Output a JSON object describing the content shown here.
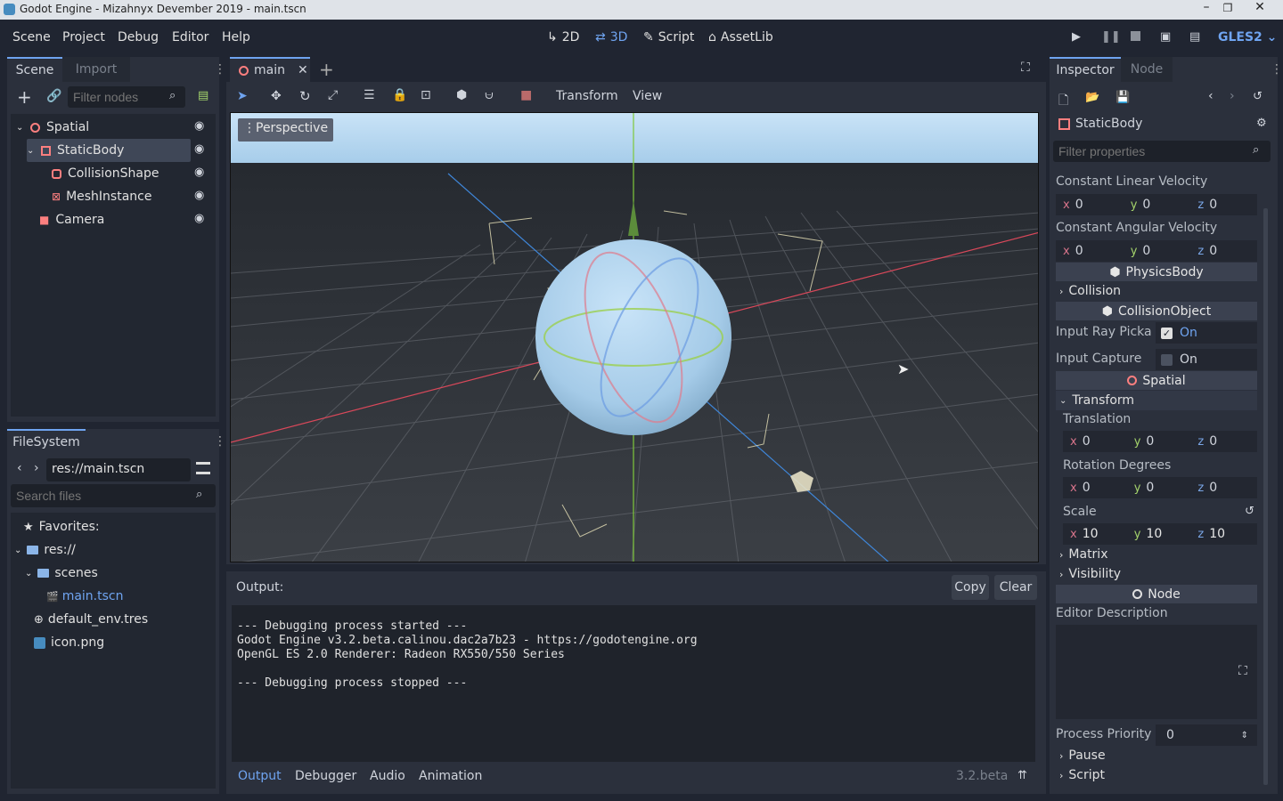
{
  "window": {
    "title": "Godot Engine - Mizahnyx Devember 2019 - main.tscn"
  },
  "menu": [
    "Scene",
    "Project",
    "Debug",
    "Editor",
    "Help"
  ],
  "modes": {
    "m2d": "2D",
    "m3d": "3D",
    "script": "Script",
    "assetlib": "AssetLib"
  },
  "renderer": "GLES2",
  "scene_dock": {
    "tabs": [
      "Scene",
      "Import"
    ],
    "filter_placeholder": "Filter nodes",
    "nodes": [
      {
        "label": "Spatial",
        "icon": "spatial-icon"
      },
      {
        "label": "StaticBody",
        "icon": "static-body-icon"
      },
      {
        "label": "CollisionShape",
        "icon": "collision-shape-icon"
      },
      {
        "label": "MeshInstance",
        "icon": "mesh-instance-icon"
      },
      {
        "label": "Camera",
        "icon": "camera-icon"
      }
    ]
  },
  "filesystem": {
    "tab": "FileSystem",
    "path": "res://main.tscn",
    "search_placeholder": "Search files",
    "favorites": "Favorites:",
    "root": "res://",
    "items": [
      "scenes",
      "main.tscn",
      "default_env.tres",
      "icon.png"
    ]
  },
  "editor": {
    "scene_tab": "main",
    "toolbar": {
      "transform": "Transform",
      "view": "View"
    },
    "viewport_label": "Perspective"
  },
  "output": {
    "label": "Output:",
    "copy": "Copy",
    "clear": "Clear",
    "lines": [
      "--- Debugging process started ---",
      "Godot Engine v3.2.beta.calinou.dac2a7b23 - https://godotengine.org",
      "OpenGL ES 2.0 Renderer: Radeon RX550/550 Series",
      "",
      "--- Debugging process stopped ---"
    ],
    "tabs": [
      "Output",
      "Debugger",
      "Audio",
      "Animation"
    ],
    "version": "3.2.beta"
  },
  "inspector": {
    "tabs": [
      "Inspector",
      "Node"
    ],
    "object": "StaticBody",
    "filter_placeholder": "Filter properties",
    "const_linear": {
      "label": "Constant Linear Velocity",
      "x": "0",
      "y": "0",
      "z": "0"
    },
    "const_angular": {
      "label": "Constant Angular Velocity",
      "x": "0",
      "y": "0",
      "z": "0"
    },
    "physics_body": "PhysicsBody",
    "collision": "Collision",
    "collision_object": "CollisionObject",
    "input_ray": {
      "label": "Input Ray Picka",
      "value": "On"
    },
    "input_capture": {
      "label": "Input Capture",
      "value": "On"
    },
    "spatial": "Spatial",
    "transform": "Transform",
    "translation": {
      "label": "Translation",
      "x": "0",
      "y": "0",
      "z": "0"
    },
    "rotation": {
      "label": "Rotation Degrees",
      "x": "0",
      "y": "0",
      "z": "0"
    },
    "scale": {
      "label": "Scale",
      "x": "10",
      "y": "10",
      "z": "10"
    },
    "matrix": "Matrix",
    "visibility": "Visibility",
    "node": "Node",
    "editor_description": "Editor Description",
    "process_priority": {
      "label": "Process Priority",
      "value": "0"
    },
    "pause": "Pause",
    "script": "Script"
  },
  "axes": {
    "x": "x",
    "y": "y",
    "z": "z"
  },
  "colors": {
    "accent": "#6fa4f0",
    "bg_dark": "#202531",
    "panel": "#2b303c",
    "selected": "#3f4757"
  }
}
